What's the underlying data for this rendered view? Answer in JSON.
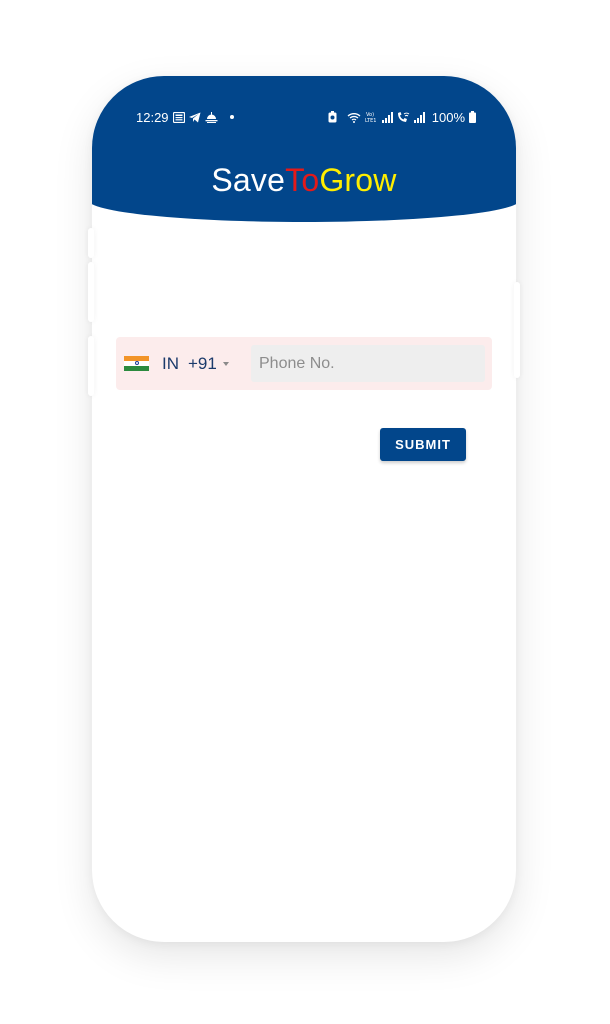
{
  "status_bar": {
    "time": "12:29",
    "battery": "100%",
    "left_icons": [
      "news-icon",
      "telegram-icon",
      "weather-icon",
      "dot-icon"
    ],
    "right_icons": [
      "alarm-icon",
      "wifi-icon",
      "volte-icon",
      "signal-icon",
      "wifi-calling-icon",
      "signal-icon",
      "battery-icon"
    ],
    "volte_label": "Vo)\nLTE1"
  },
  "app": {
    "brand_parts": [
      {
        "text": "Save",
        "color": "#ffffff"
      },
      {
        "text": "To",
        "color": "#e31a1a"
      },
      {
        "text": "Grow",
        "color": "#ffee00"
      }
    ]
  },
  "login_form": {
    "country_code": "IN",
    "dial_code": "+91",
    "phone_placeholder": "Phone No.",
    "phone_value": "",
    "submit_label": "SUBMIT"
  },
  "colors": {
    "primary": "#02468b",
    "form_background": "#fcecec",
    "input_background": "#eeeeee"
  }
}
